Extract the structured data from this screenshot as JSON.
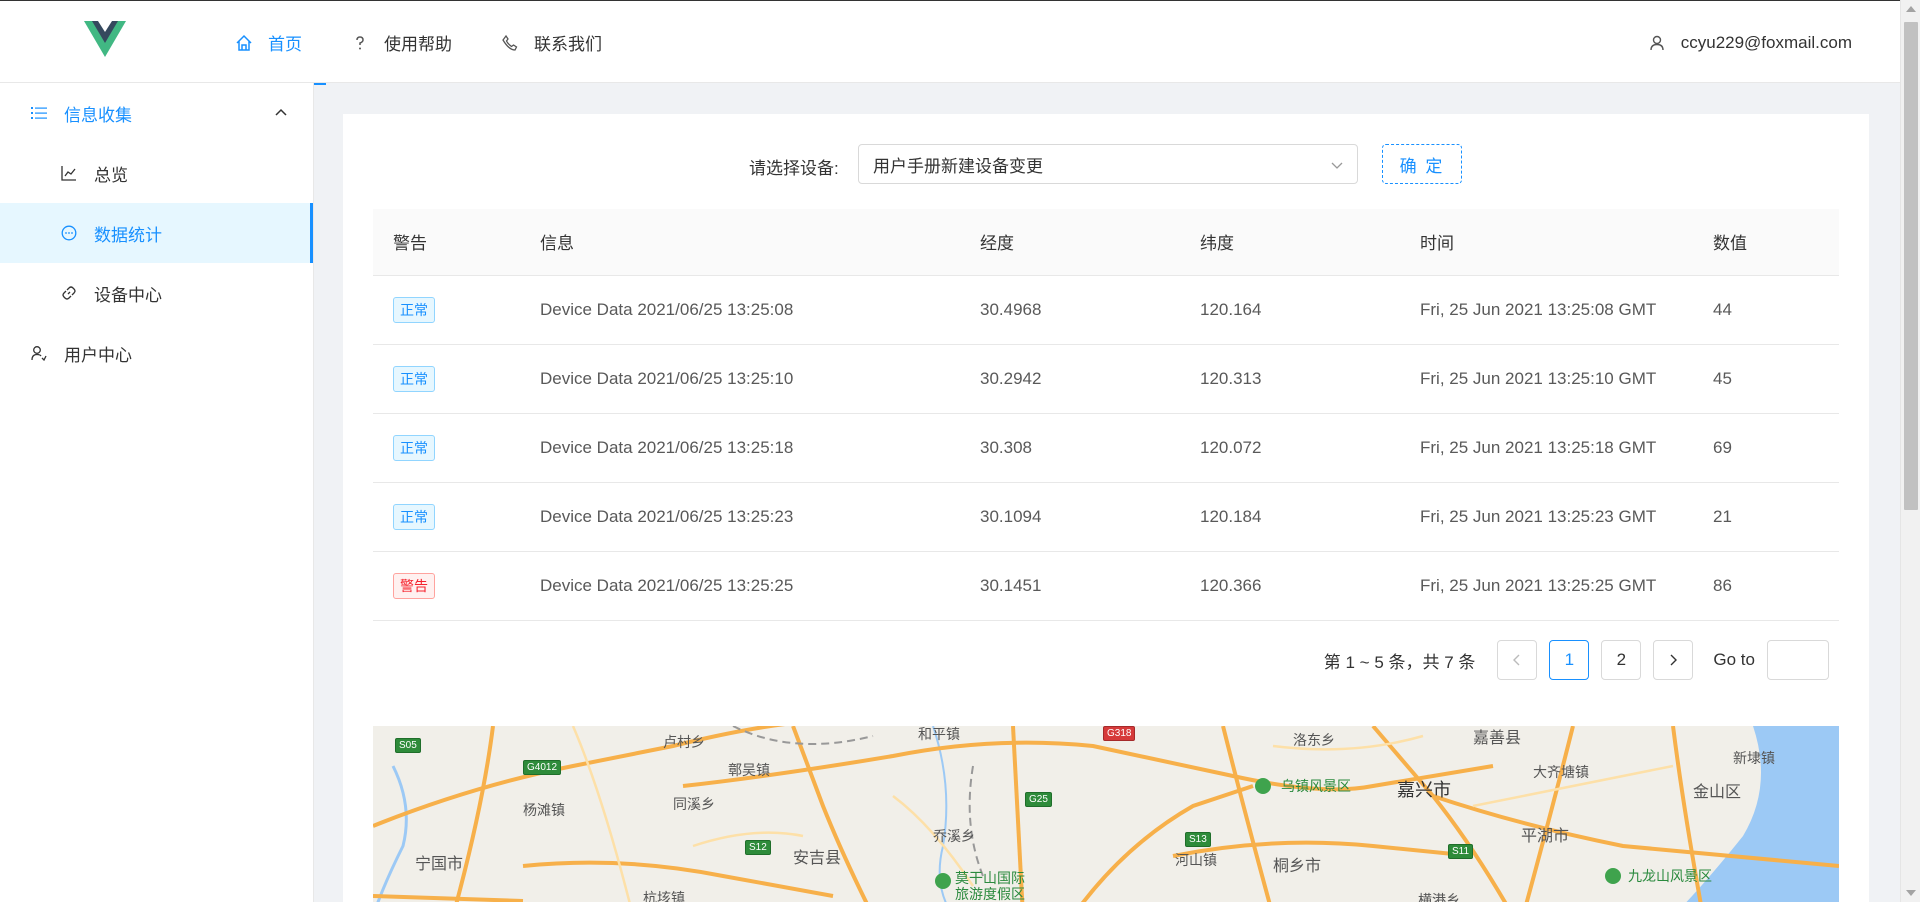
{
  "header": {
    "nav": [
      {
        "label": "首页",
        "icon": "home-icon",
        "active": true
      },
      {
        "label": "使用帮助",
        "icon": "question-icon"
      },
      {
        "label": "联系我们",
        "icon": "phone-icon"
      }
    ],
    "user_email": "ccyu229@foxmail.com"
  },
  "sidebar": {
    "group_title": "信息收集",
    "items": [
      {
        "label": "总览",
        "icon": "line-chart-icon"
      },
      {
        "label": "数据统计",
        "icon": "message-icon",
        "selected": true
      },
      {
        "label": "设备中心",
        "icon": "link-icon"
      }
    ],
    "user_center": "用户中心"
  },
  "selector": {
    "label": "请选择设备:",
    "value": "用户手册新建设备变更",
    "confirm_label": "确 定"
  },
  "table": {
    "columns": [
      "警告",
      "信息",
      "经度",
      "纬度",
      "时间",
      "数值"
    ],
    "rows": [
      {
        "status": "正常",
        "status_type": "normal",
        "info": "Device Data 2021/06/25 13:25:08",
        "lng": "30.4968",
        "lat": "120.164",
        "time": "Fri, 25 Jun 2021 13:25:08 GMT",
        "value": "44"
      },
      {
        "status": "正常",
        "status_type": "normal",
        "info": "Device Data 2021/06/25 13:25:10",
        "lng": "30.2942",
        "lat": "120.313",
        "time": "Fri, 25 Jun 2021 13:25:10 GMT",
        "value": "45"
      },
      {
        "status": "正常",
        "status_type": "normal",
        "info": "Device Data 2021/06/25 13:25:18",
        "lng": "30.308",
        "lat": "120.072",
        "time": "Fri, 25 Jun 2021 13:25:18 GMT",
        "value": "69"
      },
      {
        "status": "正常",
        "status_type": "normal",
        "info": "Device Data 2021/06/25 13:25:23",
        "lng": "30.1094",
        "lat": "120.184",
        "time": "Fri, 25 Jun 2021 13:25:23 GMT",
        "value": "21"
      },
      {
        "status": "警告",
        "status_type": "warn",
        "info": "Device Data 2021/06/25 13:25:25",
        "lng": "30.1451",
        "lat": "120.366",
        "time": "Fri, 25 Jun 2021 13:25:25 GMT",
        "value": "86"
      }
    ]
  },
  "pagination": {
    "total_text": "第 1 ~ 5 条，共 7 条",
    "pages": [
      "1",
      "2"
    ],
    "current": "1",
    "goto_label": "Go to"
  },
  "map": {
    "labels": [
      {
        "text": "卢村乡"
      },
      {
        "text": "和平镇"
      },
      {
        "text": "洛东乡"
      },
      {
        "text": "嘉善县"
      },
      {
        "text": "鄣吴镇"
      },
      {
        "text": "大齐塘镇"
      },
      {
        "text": "乌镇风景区"
      },
      {
        "text": "嘉兴市"
      },
      {
        "text": "杨滩镇"
      },
      {
        "text": "同溪乡"
      },
      {
        "text": "金山区"
      },
      {
        "text": "安吉县"
      },
      {
        "text": "乔溪乡"
      },
      {
        "text": "平湖市"
      },
      {
        "text": "宁国市"
      },
      {
        "text": "河山镇"
      },
      {
        "text": "桐乡市"
      },
      {
        "text": "九龙山风景区"
      },
      {
        "text": "莫干山国际"
      },
      {
        "text": "旅游度假区"
      },
      {
        "text": "杭垓镇"
      },
      {
        "text": "横港乡"
      },
      {
        "text": "新埭镇"
      }
    ],
    "shields": [
      "S05",
      "G4012",
      "G318",
      "G25",
      "S12",
      "S13",
      "S11"
    ]
  }
}
